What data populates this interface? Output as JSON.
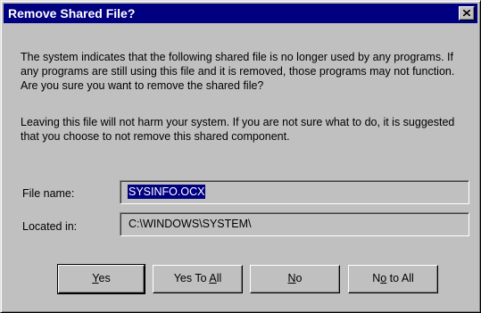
{
  "window": {
    "title": "Remove Shared File?",
    "close_icon": "close-icon"
  },
  "message": {
    "paragraph1": "The system indicates that the following shared file is no longer used by any programs.  If any programs are still using this file and it is removed, those programs may not function.  Are you sure you want to remove the shared file?",
    "paragraph2": "Leaving this file will not harm your system.  If you are not sure what to do, it is suggested that you choose to not remove this shared component."
  },
  "fields": {
    "file_name_label": "File name:",
    "file_name_value": "SYSINFO.OCX",
    "located_in_label": "Located in:",
    "located_in_value": "C:\\WINDOWS\\SYSTEM\\"
  },
  "buttons": {
    "yes": {
      "pre": "",
      "accel": "Y",
      "post": "es"
    },
    "yes_to_all": {
      "pre": "Yes To ",
      "accel": "A",
      "post": "ll"
    },
    "no": {
      "pre": "",
      "accel": "N",
      "post": "o"
    },
    "no_to_all": {
      "pre": "N",
      "accel": "o",
      "post": " to All"
    }
  },
  "colors": {
    "title_bar": "#000080",
    "dialog_face": "#c0c0c0",
    "selection": "#000080"
  }
}
